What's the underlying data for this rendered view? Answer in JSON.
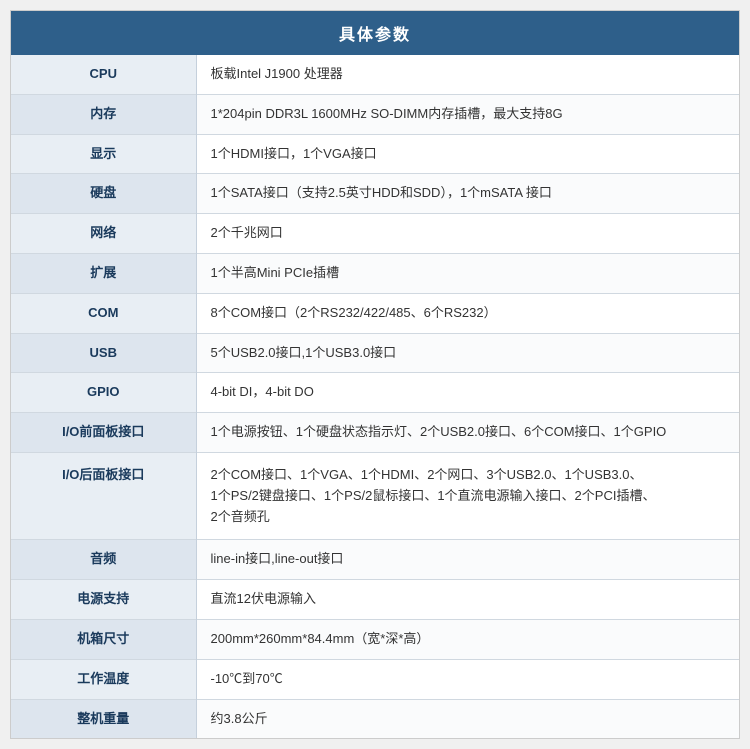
{
  "header": {
    "title": "具体参数"
  },
  "rows": [
    {
      "label": "CPU",
      "value": "板载Intel J1900 处理器"
    },
    {
      "label": "内存",
      "value": "1*204pin DDR3L 1600MHz SO-DIMM内存插槽，最大支持8G"
    },
    {
      "label": "显示",
      "value": "1个HDMI接口，1个VGA接口"
    },
    {
      "label": "硬盘",
      "value": "1个SATA接口（支持2.5英寸HDD和SDD），1个mSATA 接口"
    },
    {
      "label": "网络",
      "value": "2个千兆网口"
    },
    {
      "label": "扩展",
      "value": "1个半高Mini PCIe插槽"
    },
    {
      "label": "COM",
      "value": "8个COM接口（2个RS232/422/485、6个RS232）"
    },
    {
      "label": "USB",
      "value": "5个USB2.0接口,1个USB3.0接口"
    },
    {
      "label": "GPIO",
      "value": "4-bit DI，4-bit DO"
    },
    {
      "label": "I/O前面板接口",
      "value": "1个电源按钮、1个硬盘状态指示灯、2个USB2.0接口、6个COM接口、1个GPIO"
    },
    {
      "label": "I/O后面板接口",
      "value": "2个COM接口、1个VGA、1个HDMI、2个网口、3个USB2.0、1个USB3.0、\n1个PS/2键盘接口、1个PS/2鼠标接口、1个直流电源输入接口、2个PCI插槽、\n2个音频孔"
    },
    {
      "label": "音频",
      "value": "line-in接口,line-out接口"
    },
    {
      "label": "电源支持",
      "value": "直流12伏电源输入"
    },
    {
      "label": "机箱尺寸",
      "value": "200mm*260mm*84.4mm（宽*深*高）"
    },
    {
      "label": "工作温度",
      "value": "-10℃到70℃"
    },
    {
      "label": "整机重量",
      "value": "约3.8公斤"
    }
  ]
}
